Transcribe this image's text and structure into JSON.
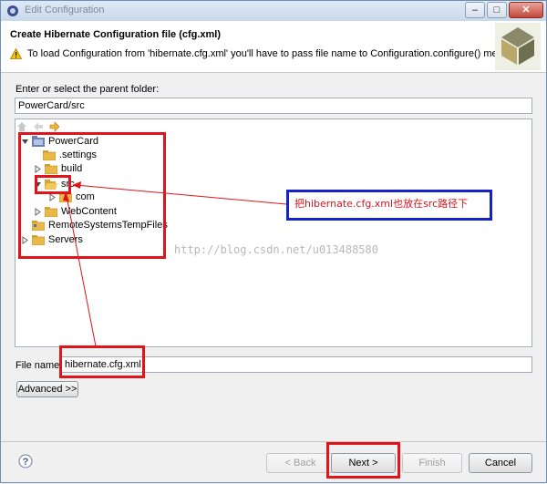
{
  "window": {
    "title": "Edit Configuration",
    "minimize_label": "–",
    "maximize_label": "□",
    "close_label": "✕"
  },
  "header": {
    "title": "Create Hibernate Configuration file (cfg.xml)",
    "message": "To load Configuration from 'hibernate.cfg.xml' you'll have to pass file name to Configuration.configure() method"
  },
  "folder": {
    "label": "Enter or select the parent folder:",
    "value": "PowerCard/src"
  },
  "tree": {
    "items": [
      {
        "label": "PowerCard",
        "type": "project",
        "expanded": true
      },
      {
        "label": ".settings",
        "type": "folder"
      },
      {
        "label": "build",
        "type": "folder"
      },
      {
        "label": "src",
        "type": "folder",
        "expanded": true
      },
      {
        "label": "com",
        "type": "folder"
      },
      {
        "label": "WebContent",
        "type": "folder"
      },
      {
        "label": "RemoteSystemsTempFiles",
        "type": "project"
      },
      {
        "label": "Servers",
        "type": "folder"
      }
    ]
  },
  "filename": {
    "label": "File name:",
    "value": "hibernate.cfg.xml"
  },
  "advanced_label": "Advanced >>",
  "annotation": {
    "callout_text": "把hibernate.cfg.xml也放在src路径下",
    "watermark": "http://blog.csdn.net/u013488580"
  },
  "buttons": {
    "back": "< Back",
    "next": "Next >",
    "finish": "Finish",
    "cancel": "Cancel"
  },
  "colors": {
    "annotation_red": "#e0141b",
    "annotation_blue": "#1422c8",
    "folder_yellow": "#e9b845"
  }
}
